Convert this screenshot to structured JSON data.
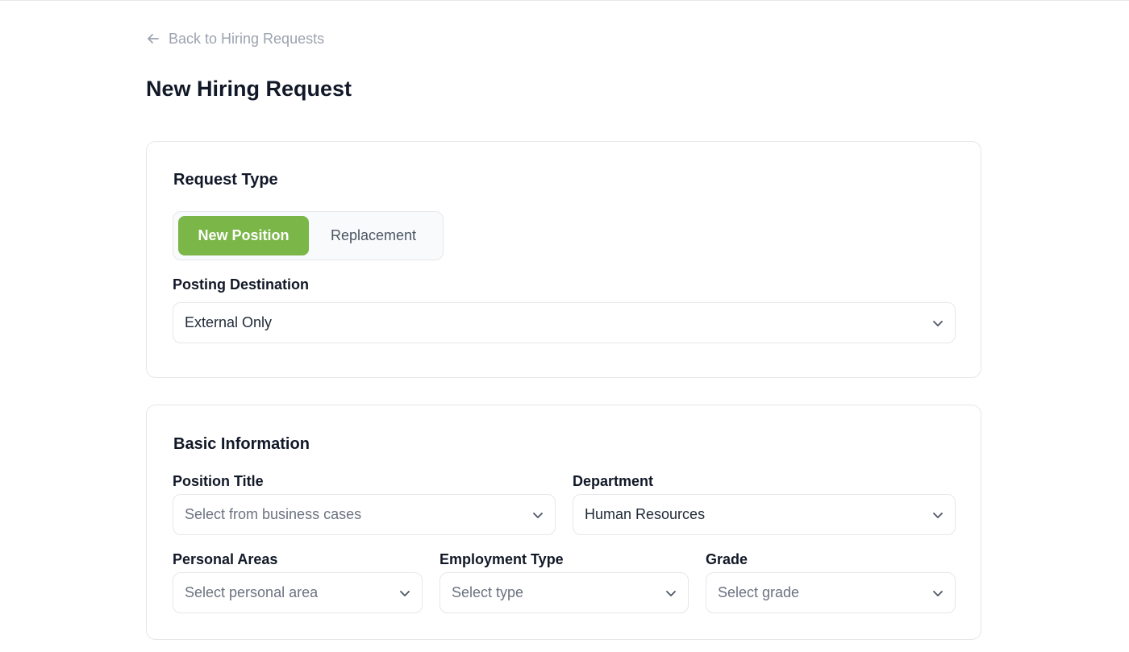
{
  "nav": {
    "back_label": "Back to Hiring Requests"
  },
  "page": {
    "title": "New Hiring Request"
  },
  "request_type": {
    "title": "Request Type",
    "options": [
      {
        "label": "New Position",
        "selected": true
      },
      {
        "label": "Replacement",
        "selected": false
      }
    ],
    "posting_destination": {
      "label": "Posting Destination",
      "value": "External Only"
    }
  },
  "basic_info": {
    "title": "Basic Information",
    "position_title": {
      "label": "Position Title",
      "placeholder": "Select from business cases"
    },
    "department": {
      "label": "Department",
      "value": "Human Resources"
    },
    "personal_areas": {
      "label": "Personal Areas",
      "placeholder": "Select personal area"
    },
    "employment_type": {
      "label": "Employment Type",
      "placeholder": "Select type"
    },
    "grade": {
      "label": "Grade",
      "placeholder": "Select grade"
    }
  },
  "colors": {
    "accent": "#7ab648",
    "border": "#e5e7eb",
    "muted_text": "#9ca3af",
    "heading": "#111827"
  },
  "icons": {
    "back": "arrow-left-icon",
    "dropdown": "chevron-down-icon"
  }
}
